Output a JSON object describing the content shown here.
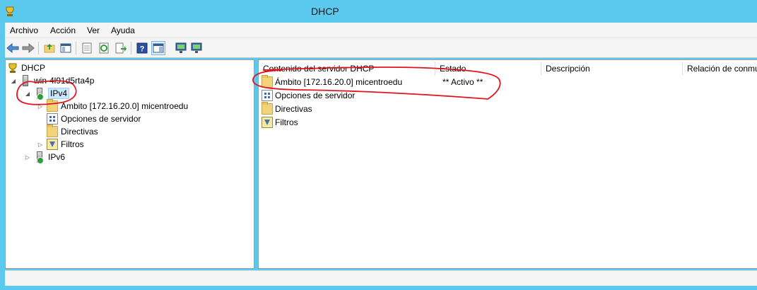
{
  "window": {
    "title": "DHCP"
  },
  "menu": [
    "Archivo",
    "Acción",
    "Ver",
    "Ayuda"
  ],
  "tree": {
    "root": "DHCP",
    "server": "win-4l91d5rta4p",
    "ipv4": "IPv4",
    "ipv4_children": [
      "Ámbito [172.16.20.0] micentroedu",
      "Opciones de servidor",
      "Directivas",
      "Filtros"
    ],
    "ipv6": "IPv6"
  },
  "list": {
    "columns": [
      "Contenido del servidor DHCP",
      "Estado",
      "Descripción",
      "Relación de conmu"
    ],
    "rows": [
      {
        "name": "Ámbito [172.16.20.0] micentroedu",
        "state": "** Activo **"
      },
      {
        "name": "Opciones de servidor",
        "state": ""
      },
      {
        "name": "Directivas",
        "state": ""
      },
      {
        "name": "Filtros",
        "state": ""
      }
    ]
  },
  "colors": {
    "titlebar": "#5bc8ee",
    "annotation": "#e0141e",
    "selection": "#cce8ff"
  }
}
